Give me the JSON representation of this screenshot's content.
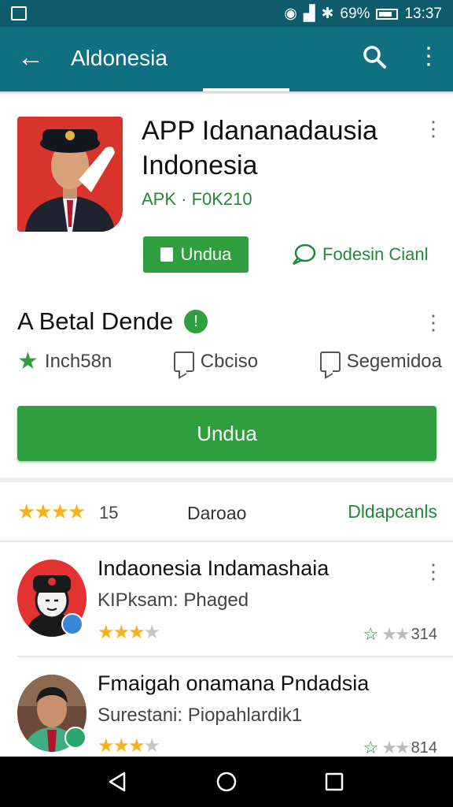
{
  "status_bar": {
    "battery_percent": "69%",
    "time": "13:37"
  },
  "app_bar": {
    "title": "Aldonesia",
    "back_icon": "arrow-back-icon",
    "search_icon": "search-icon",
    "menu_icon": "more-vert-icon"
  },
  "app_header": {
    "title": "APP Idananadausia Indonesia",
    "subtitle": "APK · F0K210",
    "install_label": "Undua",
    "secondary_label": "Fodesin Cianl"
  },
  "details": {
    "title": "A Betal Dende",
    "stats": [
      {
        "icon": "star-icon",
        "label": "Inch58n"
      },
      {
        "icon": "chat-bubble-icon",
        "label": "Cbciso"
      },
      {
        "icon": "chat-bubble-icon",
        "label": "Segemidoa"
      }
    ],
    "download_label": "Undua"
  },
  "ratings_row": {
    "stars": "★★★★",
    "count": "15",
    "middle": "Daroao",
    "right": "Dldapcanls"
  },
  "list_items": [
    {
      "title": "Indaonesia Indamashaia",
      "subtitle": "KIPksam: Phaged",
      "rating": 3,
      "right_value": "314"
    },
    {
      "title": "Fmaigah onamana Pndadsia",
      "subtitle": "Surestani: Piopahlardik1",
      "rating": 3,
      "right_value": "814"
    }
  ],
  "colors": {
    "appbar": "#0f7082",
    "statusbar": "#0e5c6b",
    "accent_green": "#2e9e3f",
    "star_yellow": "#f5b21b"
  }
}
